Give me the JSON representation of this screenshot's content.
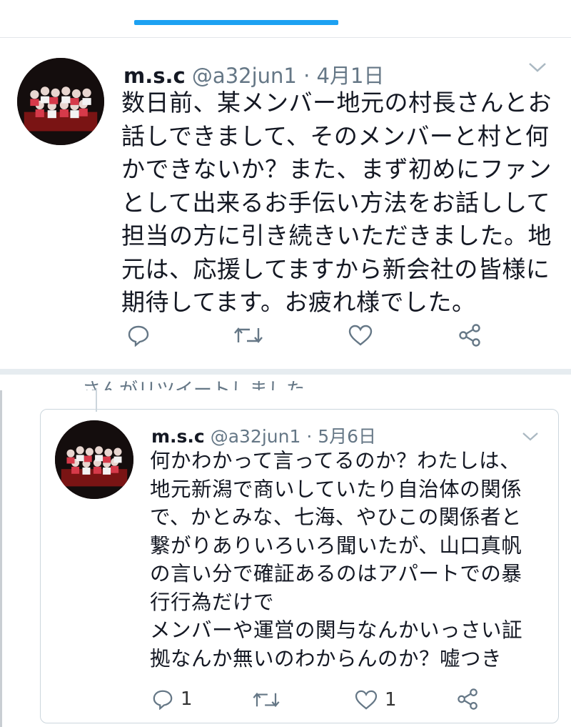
{
  "tweet1": {
    "name": "m.s.c",
    "handle": "@a32jun1",
    "separator": "·",
    "date": "4月1日",
    "text": "数日前、某メンバー地元の村長さんとお\n話しできまして、そのメンバーと村と何\nかできないか？また、まず初めにファン\nとして出来るお手伝い方法をお話しして\n担当の方に引き続きいただきました。地\n元は、応援してますから新会社の皆様に\n期待してます。お疲れ様でした。"
  },
  "retweet_banner": "さんがリツイートしました",
  "tweet2": {
    "name": "m.s.c",
    "handle": "@a32jun1",
    "separator": "·",
    "date": "5月6日",
    "text": "何かわかって言ってるのか？わたしは、\n地元新潟で商いしていたり自治体の関係\nで、かとみな、七海、やひこの関係者と\n繋がりありいろいろ聞いたが、山口真帆\nの言い分で確証あるのはアパートでの暴\n行行為だけで\nメンバーや運営の関与なんかいっさい証\n拠なんか無いのわからんのか？嘘つき",
    "reply_count": "1",
    "like_count": "1"
  },
  "icons": {
    "reply": "speech-bubble-icon",
    "retweet": "retweet-arrows-icon",
    "like": "heart-icon",
    "share": "share-icon",
    "more": "chevron-down-icon"
  },
  "colors": {
    "accent": "#1da1f2",
    "secondary_text": "#657786",
    "border": "#ccd6dd"
  }
}
